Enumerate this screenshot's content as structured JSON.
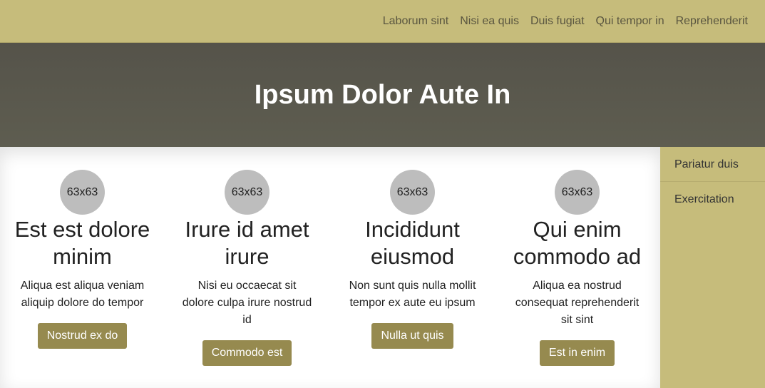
{
  "nav": {
    "items": [
      "Laborum sint",
      "Nisi ea quis",
      "Duis fugiat",
      "Qui tempor in",
      "Reprehenderit"
    ]
  },
  "hero": {
    "title": "Ipsum Dolor Aute In"
  },
  "cards": [
    {
      "avatar": "63x63",
      "title": "Est est dolore minim",
      "text": "Aliqua est aliqua veniam aliquip dolore do tempor",
      "button": "Nostrud ex do"
    },
    {
      "avatar": "63x63",
      "title": "Irure id amet irure",
      "text": "Nisi eu occaecat sit dolore culpa irure nostrud id",
      "button": "Commodo est"
    },
    {
      "avatar": "63x63",
      "title": "Incididunt eiusmod",
      "text": "Non sunt quis nulla mollit tempor ex aute eu ipsum",
      "button": "Nulla ut quis"
    },
    {
      "avatar": "63x63",
      "title": "Qui enim commodo ad",
      "text": "Aliqua ea nostrud consequat reprehenderit sit sint",
      "button": "Est in enim"
    }
  ],
  "sidebar": {
    "items": [
      "Pariatur duis",
      "Exercitation"
    ]
  },
  "colors": {
    "nav_bg": "#c6bc7b",
    "hero_bg": "#58564c",
    "button_bg": "#968a4f",
    "avatar_bg": "#bdbdbd"
  }
}
